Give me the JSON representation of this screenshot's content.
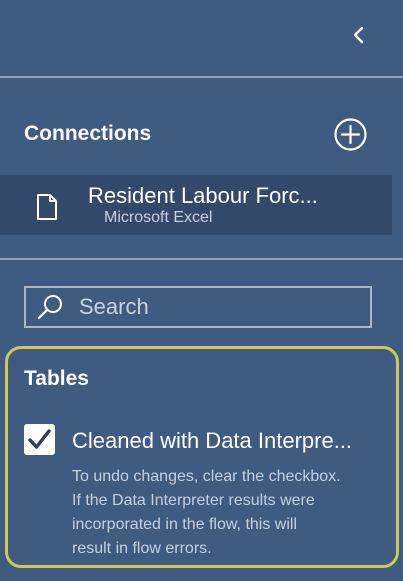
{
  "header": {
    "collapse_icon": "chevron-left-icon"
  },
  "connections": {
    "heading": "Connections",
    "add_icon": "plus-circle-icon",
    "items": [
      {
        "name": "Resident Labour Forc...",
        "type": "Microsoft Excel",
        "icon": "file-icon"
      }
    ]
  },
  "search": {
    "placeholder": "Search",
    "value": "",
    "icon": "search-icon"
  },
  "tables": {
    "heading": "Tables",
    "interpreter_checkbox": {
      "checked": true,
      "label": "Cleaned with Data Interpre...",
      "hint_lines": [
        "To undo changes, clear the checkbox.",
        "If the Data Interpreter results were",
        "incorporated in the flow, this will",
        "result in flow errors."
      ]
    }
  },
  "colors": {
    "panel_bg": "#3f5b7f",
    "selected_row_bg": "#32496a",
    "highlight_border": "#c8cb5a",
    "divider": "#93a4bb",
    "secondary_text": "#c6d0dd"
  }
}
